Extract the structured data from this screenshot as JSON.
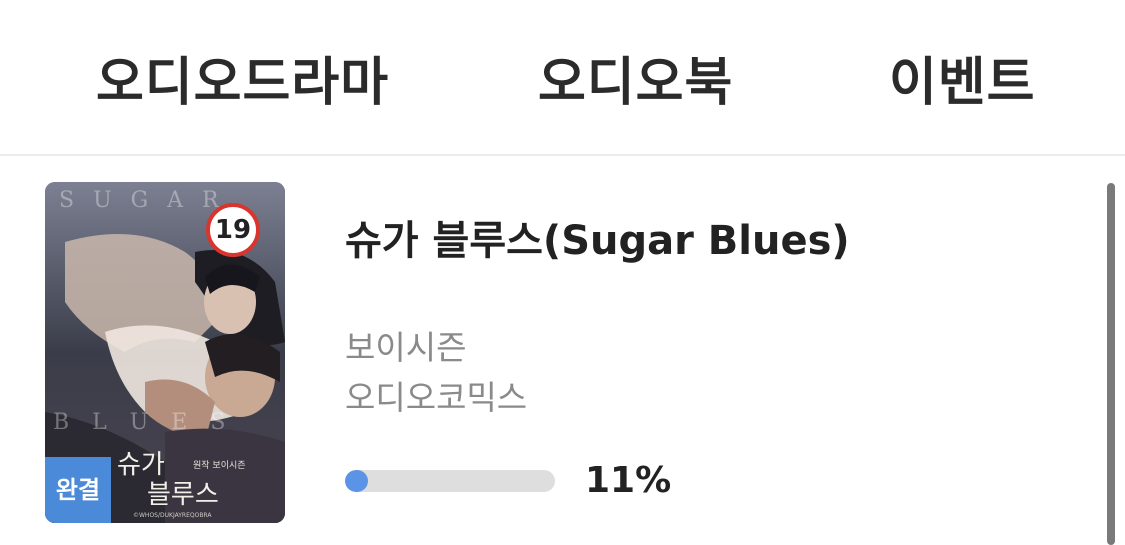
{
  "tabs": [
    {
      "label": "오디오드라마"
    },
    {
      "label": "오디오북"
    },
    {
      "label": "이벤트"
    }
  ],
  "item": {
    "title": "슈가 블루스(Sugar Blues)",
    "author": "보이시즌",
    "category": "오디오코믹스",
    "age_badge": "19",
    "status_badge": "완결",
    "progress_value": 0.11,
    "progress_label": "11%",
    "cover_text": {
      "top_title": "S U G A R",
      "bottom_title": "B L U E S",
      "korean_title_line1": "슈가",
      "korean_title_line2": "블루스",
      "korean_credit": "원작 보이시즌",
      "copyright": "©WHOS/DUKJAYREQOBRA"
    },
    "colors": {
      "progress_fill": "#5b93e6",
      "status_badge_bg": "#4a8ad8",
      "age_badge_border": "#d9352e"
    }
  }
}
